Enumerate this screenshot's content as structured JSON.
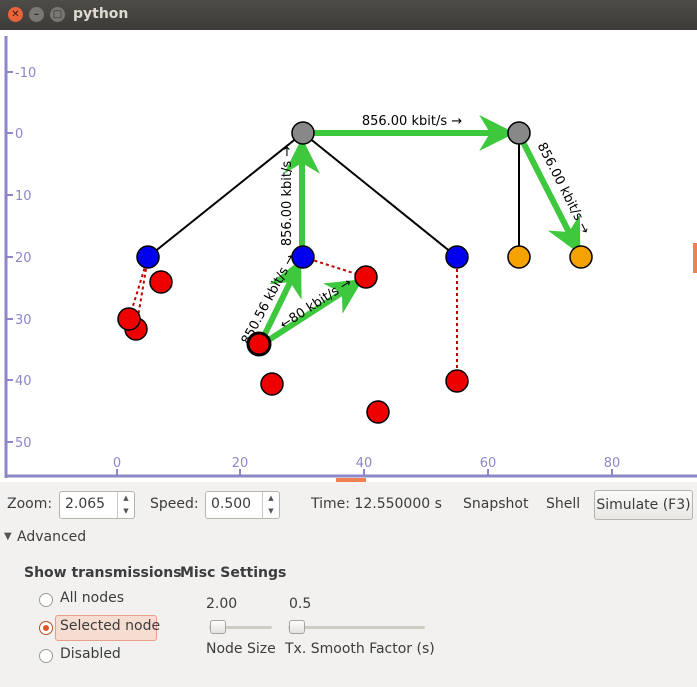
{
  "window": {
    "title": "python"
  },
  "plot": {
    "y_ticks": [
      "-10",
      "0",
      "10",
      "20",
      "30",
      "40",
      "50"
    ],
    "x_ticks": [
      "0",
      "20",
      "40",
      "60",
      "80"
    ],
    "link_labels": [
      "856.00 kbit/s →",
      "856.00 kbit/s →",
      "856.00 kbit/s →",
      "850.56 kbit/s →",
      "←80 kbit/s →"
    ],
    "node_colors": {
      "gray": "#888888",
      "blue": "#0000ee",
      "orange": "#f5a200",
      "red": "#ee0000"
    },
    "transmission_color": "#3ec83e",
    "axis_color": "#8c88c8"
  },
  "toolbar": {
    "zoom_label": "Zoom:",
    "zoom_value": "2.065",
    "speed_label": "Speed:",
    "speed_value": "0.500",
    "time_text": "Time: 12.550000 s",
    "snapshot_label": "Snapshot",
    "shell_label": "Shell",
    "simulate_label": "Simulate (F3)"
  },
  "advanced": {
    "expander_label": "Advanced",
    "show_transmissions": {
      "heading": "Show transmissions",
      "options": [
        "All nodes",
        "Selected node",
        "Disabled"
      ],
      "selected": "Selected node"
    },
    "misc": {
      "heading": "Misc Settings",
      "node_size": {
        "label": "Node Size",
        "value": "2.00",
        "level": 0.05
      },
      "smooth_factor": {
        "label": "Tx. Smooth Factor (s)",
        "value": "0.5",
        "level": 0.05
      }
    }
  }
}
